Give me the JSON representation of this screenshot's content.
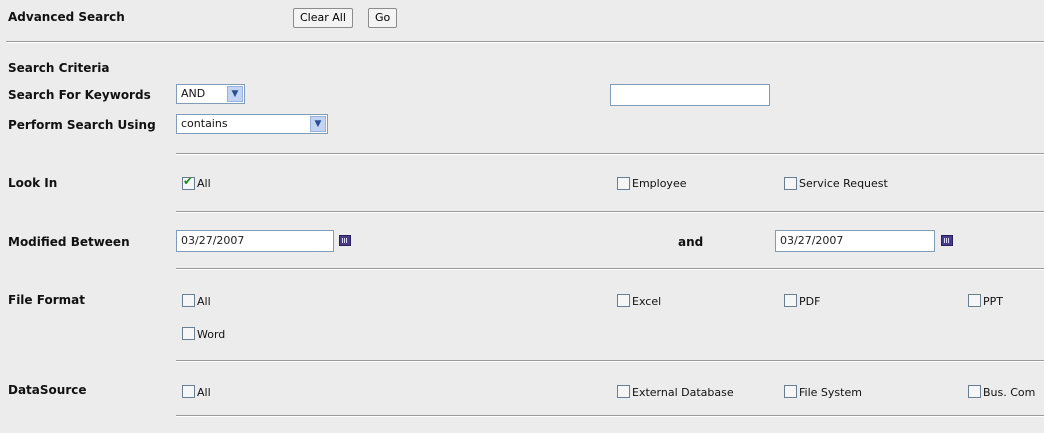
{
  "header": {
    "title": "Advanced Search",
    "clear_label": "Clear All",
    "go_label": "Go"
  },
  "criteria": {
    "section_title": "Search Criteria",
    "keywords_label": "Search For Keywords",
    "keywords_operator": "AND",
    "keywords_value": "",
    "perform_label": "Perform Search Using",
    "perform_value": "contains"
  },
  "look_in": {
    "label": "Look In",
    "options": [
      {
        "label": "All",
        "checked": true
      },
      {
        "label": "Employee",
        "checked": false
      },
      {
        "label": "Service Request",
        "checked": false
      }
    ]
  },
  "modified": {
    "label": "Modified Between",
    "from": "03/27/2007",
    "and_label": "and",
    "to": "03/27/2007"
  },
  "file_format": {
    "label": "File Format",
    "options": [
      {
        "label": "All",
        "checked": false
      },
      {
        "label": "Excel",
        "checked": false
      },
      {
        "label": "PDF",
        "checked": false
      },
      {
        "label": "PPT",
        "checked": false
      },
      {
        "label": "Word",
        "checked": false
      }
    ]
  },
  "datasource": {
    "label": "DataSource",
    "options": [
      {
        "label": "All",
        "checked": false
      },
      {
        "label": "External Database",
        "checked": false
      },
      {
        "label": "File System",
        "checked": false
      },
      {
        "label": "Bus. Com",
        "checked": false
      }
    ]
  }
}
